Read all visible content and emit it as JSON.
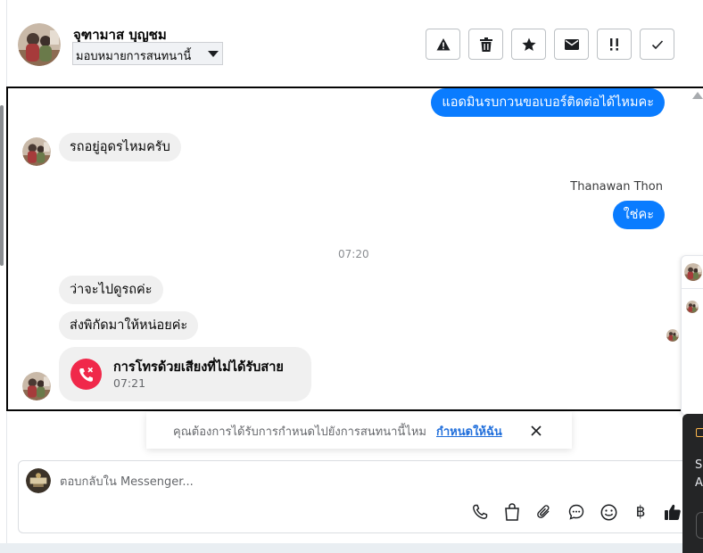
{
  "header": {
    "contact_name": "จุฑามาส บุญชม",
    "assign_label": "มอบหมายการสนทนานี้",
    "actions": [
      {
        "name": "spam-button",
        "icon": "warning-icon"
      },
      {
        "name": "delete-button",
        "icon": "trash-icon"
      },
      {
        "name": "follow-up-button",
        "icon": "star-icon"
      },
      {
        "name": "mark-unread-button",
        "icon": "envelope-icon"
      },
      {
        "name": "priority-button",
        "icon": "priority-icon"
      },
      {
        "name": "mark-done-button",
        "icon": "check-icon"
      }
    ]
  },
  "conversation": {
    "messages": [
      {
        "direction": "outgoing",
        "text": "แอดมินรบกวนขอเบอร์ติดต่อได้ไหมคะ"
      },
      {
        "direction": "incoming",
        "text": "รถอยู่อุดรไหมครับ"
      },
      {
        "direction": "outgoing",
        "sender": "Thanawan Thon",
        "text": "ใช่คะ"
      },
      {
        "direction": "incoming",
        "text": "ว่าจะไปดูรถค่ะ"
      },
      {
        "direction": "incoming",
        "text": "ส่งพิกัดมาให้หน่อยค่ะ"
      }
    ],
    "time_divider": "07:20",
    "missed_call": {
      "title": "การโทรด้วยเสียงที่ไม่ได้รับสาย",
      "time": "07:21"
    }
  },
  "reminder": {
    "text": "คุณต้องการได้รับการกำหนดไปยังการสนทนานี้ไหม",
    "link": "กำหนดให้ฉัน"
  },
  "composer": {
    "placeholder": "ตอบกลับใน Messenger...",
    "tools": [
      "phone-icon",
      "shopping-bag-icon",
      "paperclip-icon",
      "chat-bubble-icon",
      "emoji-icon",
      "baht-icon",
      "thumbs-up-icon"
    ],
    "baht_symbol": "฿"
  },
  "side_panel": {
    "text_line1": "S",
    "text_line2": "A"
  },
  "colors": {
    "outgoing_bubble": "#0a7cff",
    "incoming_bubble": "#f0f0f0",
    "missed_call": "#f0284a",
    "link": "#216fdb"
  }
}
